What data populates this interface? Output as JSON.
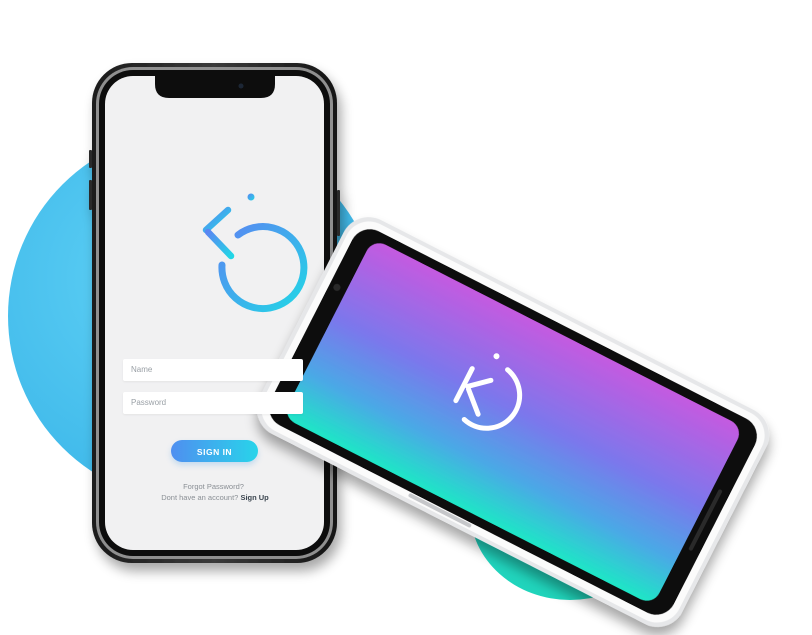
{
  "login": {
    "name_placeholder": "Name",
    "password_placeholder": "Password",
    "signin_label": "SIGN IN",
    "forgot_label": "Forgot Password?",
    "account_prompt": "Dont have an account?",
    "signup_label": "Sign Up"
  },
  "colors": {
    "blob_blue": "#3fb9ea",
    "blob_teal": "#1fd3b7",
    "gradient_top": "#c45ae0",
    "gradient_mid": "#6c7ef0",
    "gradient_bottom": "#1ee6c6",
    "logo_blue": "#4f8ff0",
    "logo_cyan": "#28d4ea"
  },
  "icons": {
    "app_logo": "k-circle-logo"
  }
}
